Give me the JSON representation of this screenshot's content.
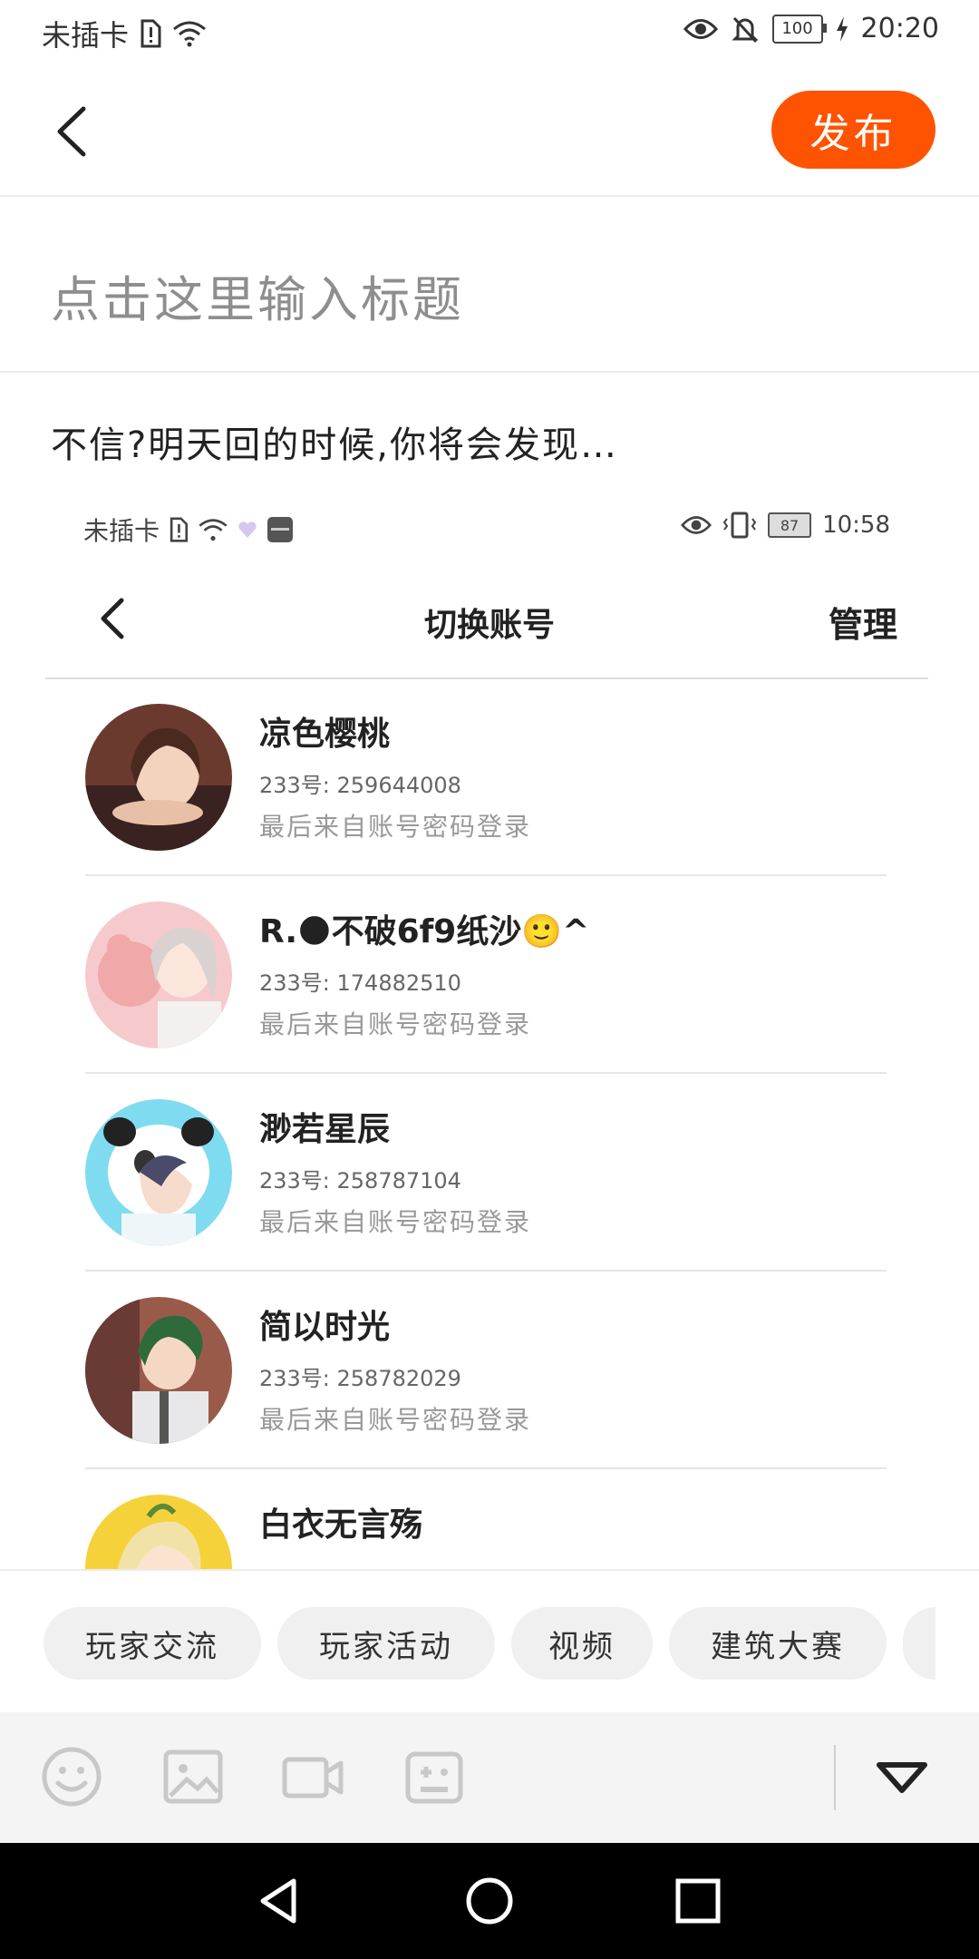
{
  "status_bar": {
    "carrier": "未插卡",
    "battery": "100",
    "time": "20:20"
  },
  "header": {
    "publish_label": "发布"
  },
  "editor": {
    "title_placeholder": "点击这里输入标题",
    "body_text": "不信?明天回的时候,你将会发现…"
  },
  "embedded_screenshot": {
    "status_bar": {
      "carrier": "未插卡",
      "battery": "87",
      "time": "10:58"
    },
    "title": "切换账号",
    "manage_label": "管理",
    "accounts": [
      {
        "name": "凉色樱桃",
        "id": "233号: 259644008",
        "login": "最后来自账号密码登录"
      },
      {
        "name": "R.🌑不破6f9纸沙🙂^",
        "id": "233号: 174882510",
        "login": "最后来自账号密码登录"
      },
      {
        "name": "渺若星辰",
        "id": "233号: 258787104",
        "login": "最后来自账号密码登录"
      },
      {
        "name": "简以时光",
        "id": "233号: 258782029",
        "login": "最后来自账号密码登录"
      },
      {
        "name": "白衣无言殇"
      }
    ]
  },
  "tags": [
    "玩家交流",
    "玩家活动",
    "视频",
    "建筑大赛"
  ],
  "toolbar": {
    "icons": [
      "emoji-icon",
      "image-icon",
      "video-icon",
      "game-icon",
      "collapse-icon"
    ]
  },
  "colors": {
    "accent": "#fe5300"
  }
}
